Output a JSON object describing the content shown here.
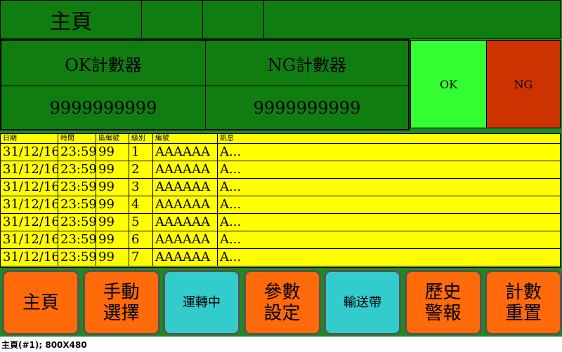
{
  "header": {
    "title": "主頁"
  },
  "counters": {
    "ok_label": "OK計數器",
    "ng_label": "NG計數器",
    "ok_value": "9999999999",
    "ng_value": "9999999999"
  },
  "indicators": {
    "ok": {
      "label": "OK",
      "color": "#33ff33"
    },
    "ng": {
      "label": "NG",
      "color": "#cc3300"
    }
  },
  "table": {
    "columns": [
      "日期",
      "時間",
      "區編號",
      "級別",
      "編號",
      "訊息"
    ],
    "rows": [
      [
        "31/12/16",
        "23:59",
        "99",
        "1",
        "AAAAAA",
        "A..."
      ],
      [
        "31/12/16",
        "23:59",
        "99",
        "2",
        "AAAAAA",
        "A..."
      ],
      [
        "31/12/16",
        "23:59",
        "99",
        "3",
        "AAAAAA",
        "A..."
      ],
      [
        "31/12/16",
        "23:59",
        "99",
        "4",
        "AAAAAA",
        "A..."
      ],
      [
        "31/12/16",
        "23:59",
        "99",
        "5",
        "AAAAAA",
        "A..."
      ],
      [
        "31/12/16",
        "23:59",
        "99",
        "6",
        "AAAAAA",
        "A..."
      ],
      [
        "31/12/16",
        "23:59",
        "99",
        "7",
        "AAAAAA",
        "A..."
      ]
    ]
  },
  "buttons": [
    {
      "label": "主頁",
      "color": "orange"
    },
    {
      "label": "手動\n選擇",
      "color": "orange"
    },
    {
      "label": "運轉中",
      "color": "cyan"
    },
    {
      "label": "參數\n設定",
      "color": "orange"
    },
    {
      "label": "輸送帶",
      "color": "cyan"
    },
    {
      "label": "歷史\n警報",
      "color": "orange"
    },
    {
      "label": "計數\n重置",
      "color": "orange"
    }
  ],
  "status": "主頁(#1); 800X480"
}
